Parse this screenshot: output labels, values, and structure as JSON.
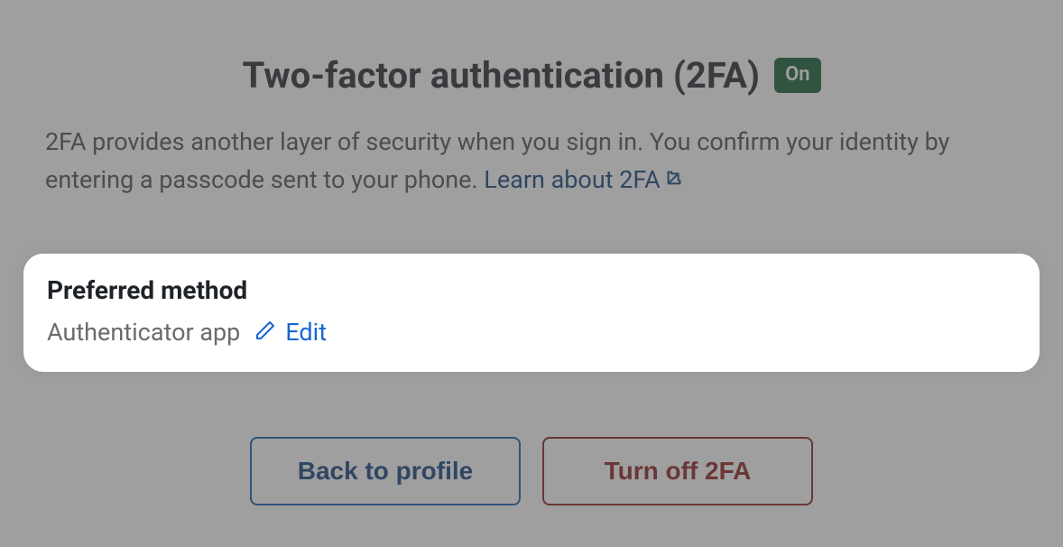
{
  "header": {
    "title": "Two-factor authentication (2FA)",
    "status": "On"
  },
  "description": {
    "text": "2FA provides another layer of security when you sign in. You confirm your identity by entering a passcode sent to your phone. ",
    "link_text": "Learn about 2FA"
  },
  "preferred_method": {
    "heading": "Preferred method",
    "value": "Authenticator app",
    "edit_label": "Edit"
  },
  "buttons": {
    "back": "Back to profile",
    "turn_off": "Turn off 2FA"
  }
}
